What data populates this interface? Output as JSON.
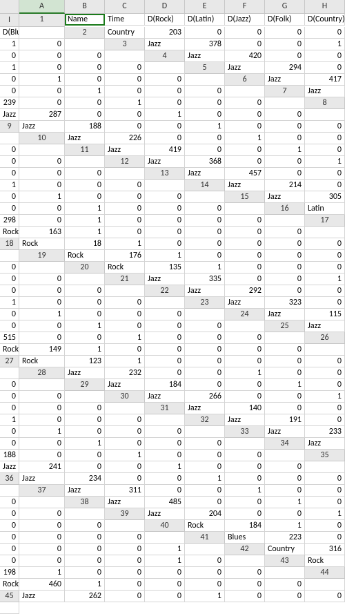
{
  "columns": [
    "A",
    "B",
    "C",
    "D",
    "E",
    "F",
    "G",
    "H",
    "I"
  ],
  "headers": [
    "Name",
    "Time",
    "D(Rock)",
    "D(Latin)",
    "D(Jazz)",
    "D(Folk)",
    "D(Country)",
    "D(Blues)"
  ],
  "active_cell": "A1",
  "selected_column": "A",
  "rows": [
    {
      "n": 2,
      "v": [
        "Country",
        203,
        0,
        0,
        0,
        0,
        1,
        0
      ]
    },
    {
      "n": 3,
      "v": [
        "Jazz",
        378,
        0,
        0,
        1,
        0,
        0,
        0
      ]
    },
    {
      "n": 4,
      "v": [
        "Jazz",
        420,
        0,
        0,
        1,
        0,
        0,
        0
      ]
    },
    {
      "n": 5,
      "v": [
        "Jazz",
        294,
        0,
        0,
        1,
        0,
        0,
        0
      ]
    },
    {
      "n": 6,
      "v": [
        "Jazz",
        417,
        0,
        0,
        1,
        0,
        0,
        0
      ]
    },
    {
      "n": 7,
      "v": [
        "Jazz",
        239,
        0,
        0,
        1,
        0,
        0,
        0
      ]
    },
    {
      "n": 8,
      "v": [
        "Jazz",
        287,
        0,
        0,
        1,
        0,
        0,
        0
      ]
    },
    {
      "n": 9,
      "v": [
        "Jazz",
        188,
        0,
        0,
        1,
        0,
        0,
        0
      ]
    },
    {
      "n": 10,
      "v": [
        "Jazz",
        226,
        0,
        0,
        1,
        0,
        0,
        0
      ]
    },
    {
      "n": 11,
      "v": [
        "Jazz",
        419,
        0,
        0,
        1,
        0,
        0,
        0
      ]
    },
    {
      "n": 12,
      "v": [
        "Jazz",
        368,
        0,
        0,
        1,
        0,
        0,
        0
      ]
    },
    {
      "n": 13,
      "v": [
        "Jazz",
        457,
        0,
        0,
        1,
        0,
        0,
        0
      ]
    },
    {
      "n": 14,
      "v": [
        "Jazz",
        214,
        0,
        0,
        1,
        0,
        0,
        0
      ]
    },
    {
      "n": 15,
      "v": [
        "Jazz",
        305,
        0,
        0,
        1,
        0,
        0,
        0
      ]
    },
    {
      "n": 16,
      "v": [
        "Latin",
        298,
        0,
        1,
        0,
        0,
        0,
        0
      ]
    },
    {
      "n": 17,
      "v": [
        "Rock",
        163,
        1,
        0,
        0,
        0,
        0,
        0
      ]
    },
    {
      "n": 18,
      "v": [
        "Rock",
        18,
        1,
        0,
        0,
        0,
        0,
        0
      ]
    },
    {
      "n": 19,
      "v": [
        "Rock",
        176,
        1,
        0,
        0,
        0,
        0,
        0
      ]
    },
    {
      "n": 20,
      "v": [
        "Rock",
        135,
        1,
        0,
        0,
        0,
        0,
        0
      ]
    },
    {
      "n": 21,
      "v": [
        "Jazz",
        335,
        0,
        0,
        1,
        0,
        0,
        0
      ]
    },
    {
      "n": 22,
      "v": [
        "Jazz",
        292,
        0,
        0,
        1,
        0,
        0,
        0
      ]
    },
    {
      "n": 23,
      "v": [
        "Jazz",
        323,
        0,
        0,
        1,
        0,
        0,
        0
      ]
    },
    {
      "n": 24,
      "v": [
        "Jazz",
        115,
        0,
        0,
        1,
        0,
        0,
        0
      ]
    },
    {
      "n": 25,
      "v": [
        "Jazz",
        515,
        0,
        0,
        1,
        0,
        0,
        0
      ]
    },
    {
      "n": 26,
      "v": [
        "Rock",
        149,
        1,
        0,
        0,
        0,
        0,
        0
      ]
    },
    {
      "n": 27,
      "v": [
        "Rock",
        123,
        1,
        0,
        0,
        0,
        0,
        0
      ]
    },
    {
      "n": 28,
      "v": [
        "Jazz",
        232,
        0,
        0,
        1,
        0,
        0,
        0
      ]
    },
    {
      "n": 29,
      "v": [
        "Jazz",
        184,
        0,
        0,
        1,
        0,
        0,
        0
      ]
    },
    {
      "n": 30,
      "v": [
        "Jazz",
        266,
        0,
        0,
        1,
        0,
        0,
        0
      ]
    },
    {
      "n": 31,
      "v": [
        "Jazz",
        140,
        0,
        0,
        1,
        0,
        0,
        0
      ]
    },
    {
      "n": 32,
      "v": [
        "Jazz",
        191,
        0,
        0,
        1,
        0,
        0,
        0
      ]
    },
    {
      "n": 33,
      "v": [
        "Jazz",
        233,
        0,
        0,
        1,
        0,
        0,
        0
      ]
    },
    {
      "n": 34,
      "v": [
        "Jazz",
        188,
        0,
        0,
        1,
        0,
        0,
        0
      ]
    },
    {
      "n": 35,
      "v": [
        "Jazz",
        241,
        0,
        0,
        1,
        0,
        0,
        0
      ]
    },
    {
      "n": 36,
      "v": [
        "Jazz",
        234,
        0,
        0,
        1,
        0,
        0,
        0
      ]
    },
    {
      "n": 37,
      "v": [
        "Jazz",
        311,
        0,
        0,
        1,
        0,
        0,
        0
      ]
    },
    {
      "n": 38,
      "v": [
        "Jazz",
        485,
        0,
        0,
        1,
        0,
        0,
        0
      ]
    },
    {
      "n": 39,
      "v": [
        "Jazz",
        204,
        0,
        0,
        1,
        0,
        0,
        0
      ]
    },
    {
      "n": 40,
      "v": [
        "Rock",
        184,
        1,
        0,
        0,
        0,
        0,
        0
      ]
    },
    {
      "n": 41,
      "v": [
        "Blues",
        223,
        0,
        0,
        0,
        0,
        0,
        1
      ]
    },
    {
      "n": 42,
      "v": [
        "Country",
        316,
        0,
        0,
        0,
        0,
        1,
        0
      ]
    },
    {
      "n": 43,
      "v": [
        "Rock",
        198,
        1,
        0,
        0,
        0,
        0,
        0
      ]
    },
    {
      "n": 44,
      "v": [
        "Rock",
        460,
        1,
        0,
        0,
        0,
        0,
        0
      ]
    },
    {
      "n": 45,
      "v": [
        "Jazz",
        262,
        0,
        0,
        1,
        0,
        0,
        0
      ]
    }
  ]
}
